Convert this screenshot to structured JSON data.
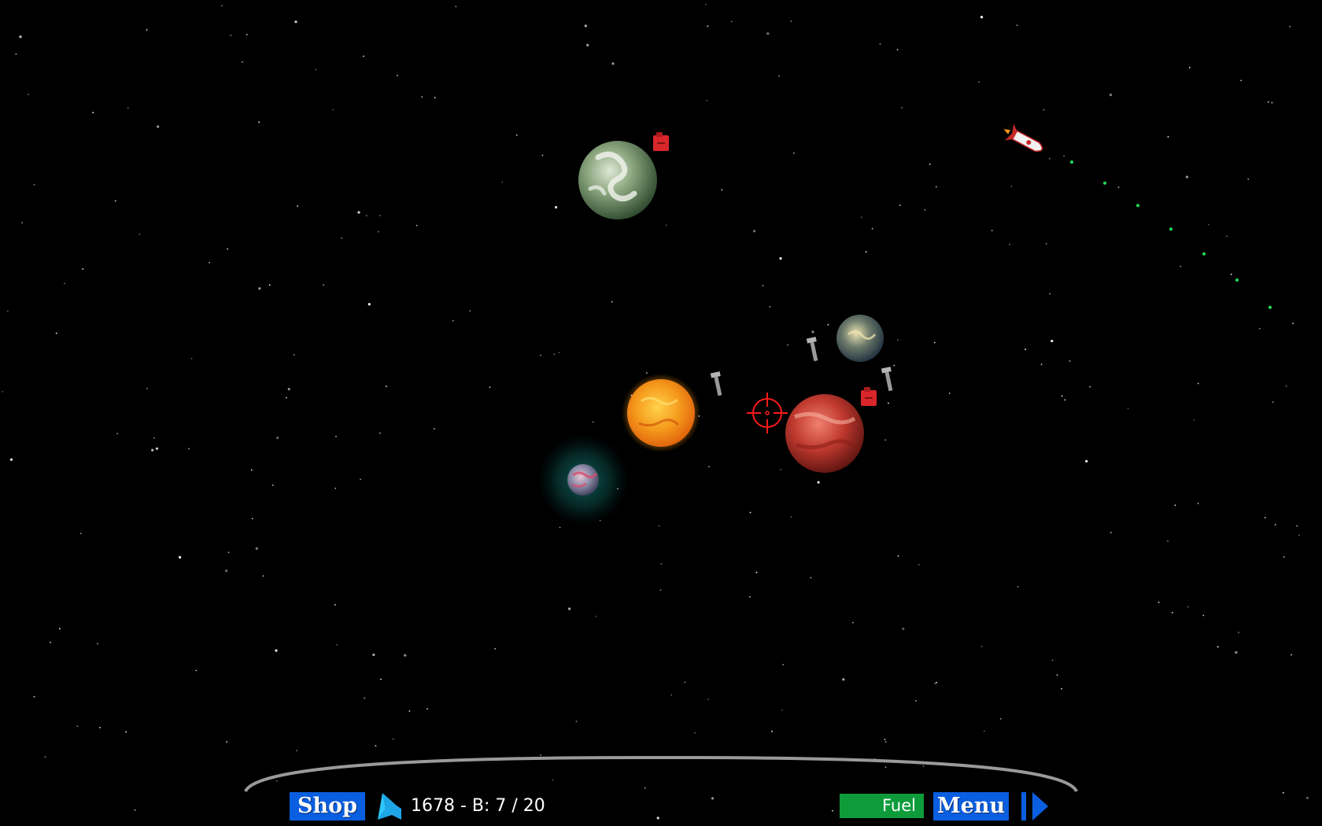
{
  "hud": {
    "shop_label": "Shop",
    "status_text": "1678 - B: 7 / 20",
    "fuel_label": "Fuel",
    "fuel_level": 1.0,
    "menu_label": "Menu"
  },
  "icons": {
    "direction": "direction-arrow-icon",
    "play": "play-icon",
    "crosshair": "crosshair-icon",
    "ship": "rocket-ship-icon",
    "fuel_can": "fuel-can-icon",
    "bolt": "bolt-icon"
  },
  "colors": {
    "background": "#000000",
    "button": "#0a5fe0",
    "fuel": "#0e9c3a",
    "crosshair": "#ff1a1a",
    "trail": "#1fdc5a",
    "orbit_arc": "#9a9a9a",
    "direction_arrow": "#1ea6e8"
  }
}
